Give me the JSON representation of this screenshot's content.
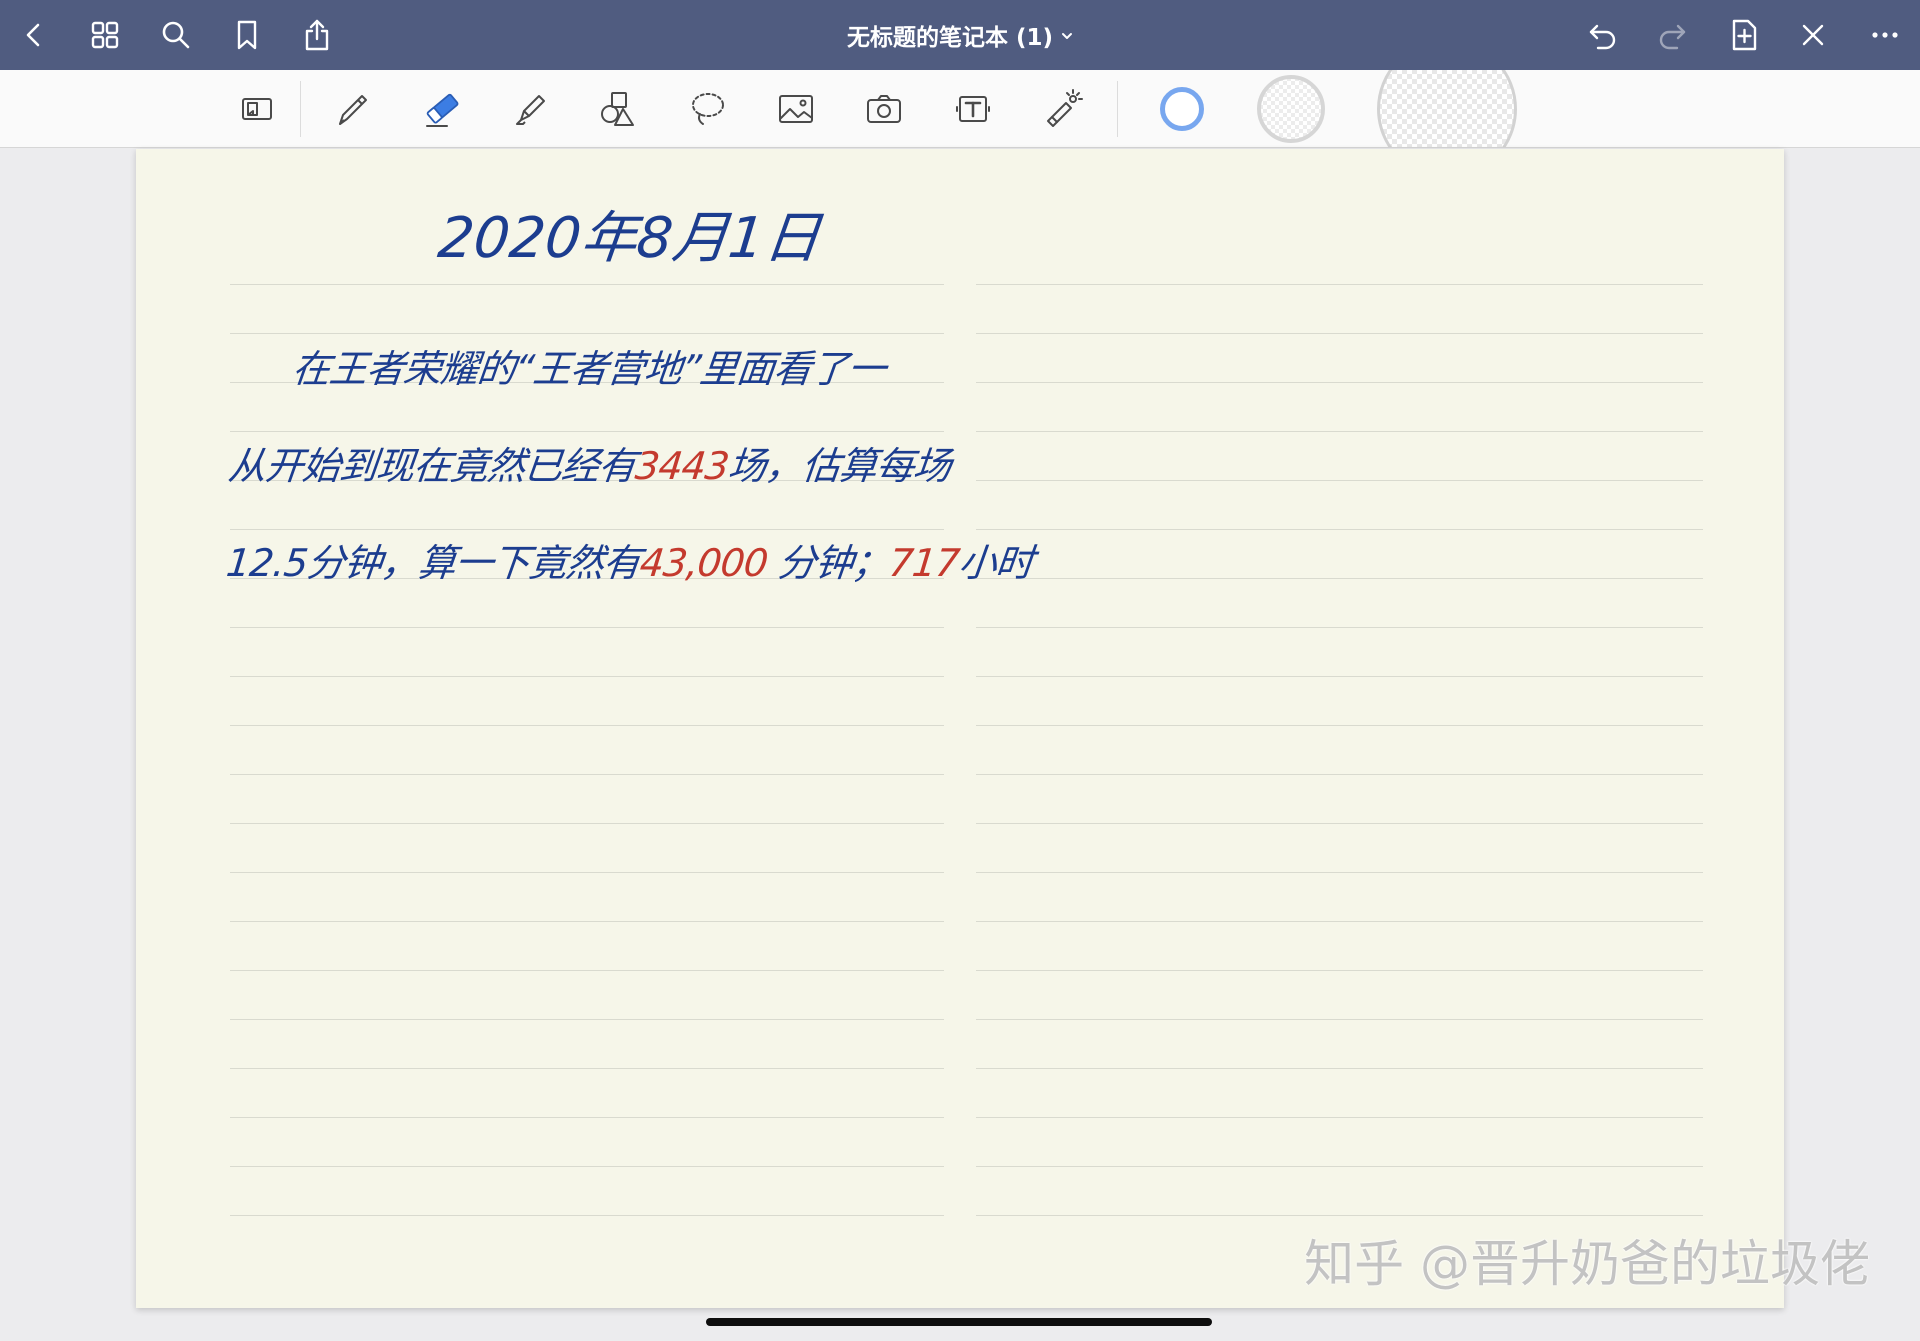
{
  "app": {
    "title": "无标题的笔记本 (1)",
    "title_chevron_icon": "chevron-down-icon"
  },
  "nav": {
    "left_icons": [
      "back-icon",
      "grid-icon",
      "search-icon",
      "bookmark-icon",
      "share-icon"
    ],
    "right_icons": [
      "undo-icon",
      "redo-icon",
      "add-page-icon",
      "close-icon",
      "more-icon"
    ]
  },
  "toolbar": {
    "tools": [
      "page-layout-icon",
      "pen-icon",
      "eraser-icon",
      "highlighter-icon",
      "shapes-icon",
      "lasso-icon",
      "image-icon",
      "camera-icon",
      "text-box-icon",
      "laser-pointer-icon"
    ],
    "selected_tool": "eraser-icon",
    "swatches": [
      "blue-ring",
      "gray-ring",
      "checkered-large"
    ]
  },
  "colors": {
    "topbar": "#505c80",
    "page": "#f6f6e9",
    "ink_blue": "#1c3d8f",
    "ink_red": "#c43a2e",
    "accent": "#3c7de3"
  },
  "note": {
    "date": "2020年8月1日",
    "lines": [
      {
        "segments": [
          {
            "text": "在王者荣耀的“王者营地”里面看了一",
            "ink": "blue"
          }
        ]
      },
      {
        "segments": [
          {
            "text": "从开始到现在竟然已经有",
            "ink": "blue"
          },
          {
            "text": "3443",
            "ink": "red"
          },
          {
            "text": "场，估算每场",
            "ink": "blue"
          }
        ]
      },
      {
        "segments": [
          {
            "text": "12.5分钟，算一下竟然有",
            "ink": "blue"
          },
          {
            "text": "43,000",
            "ink": "red"
          },
          {
            "text": " 分钟；",
            "ink": "blue"
          },
          {
            "text": "717",
            "ink": "red"
          },
          {
            "text": "小时",
            "ink": "blue"
          }
        ]
      }
    ]
  },
  "watermark": "知乎 @晋升奶爸的垃圾佬"
}
